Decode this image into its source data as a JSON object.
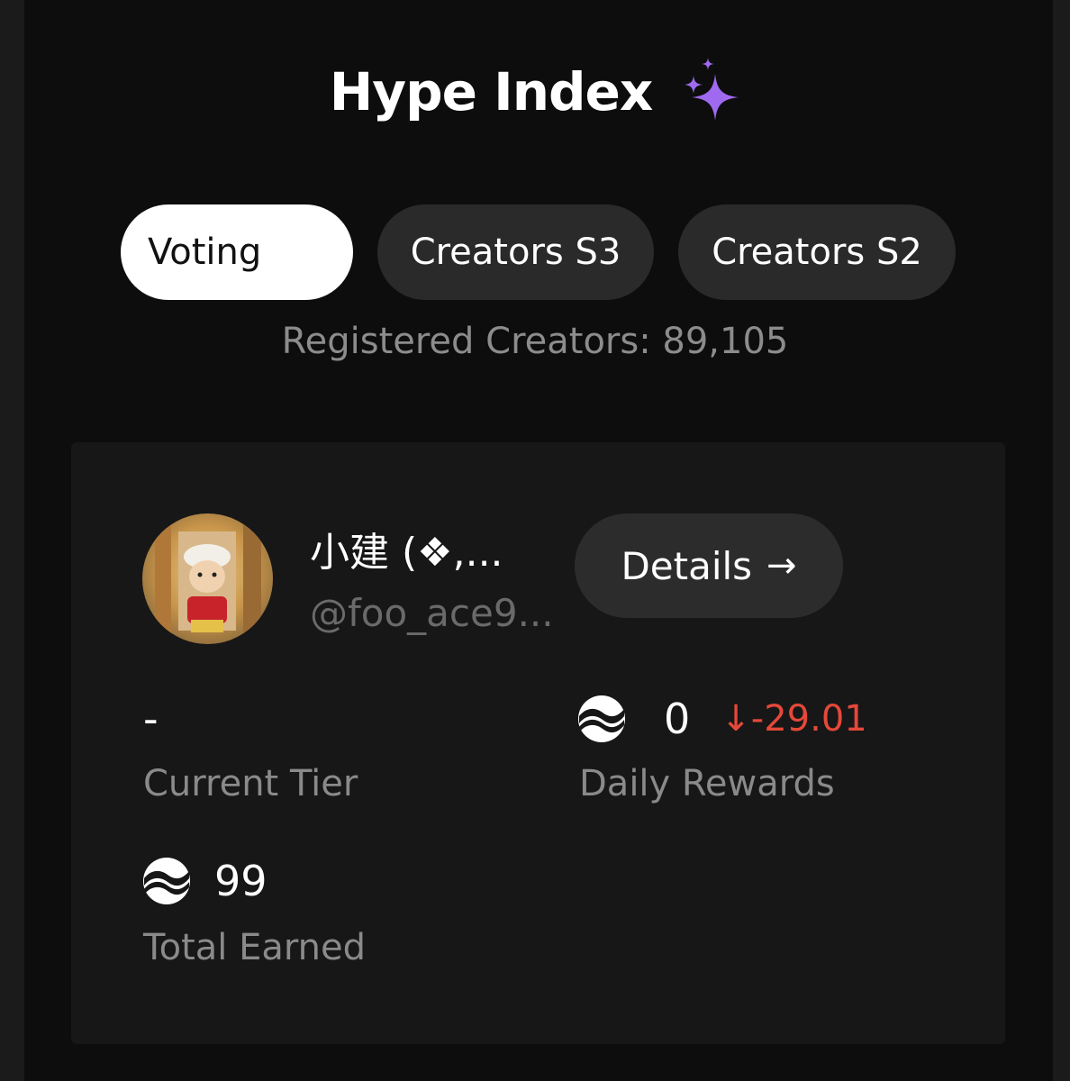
{
  "header": {
    "title": "Hype Index",
    "title_icon": "sparkle-icon",
    "accent_color": "#a06af0"
  },
  "tabs": [
    {
      "label": "Voting",
      "active": true
    },
    {
      "label": "Creators S3",
      "active": false
    },
    {
      "label": "Creators S2",
      "active": false
    }
  ],
  "registered_creators": "Registered Creators: 89,105",
  "card": {
    "user": {
      "display_name": "小建 (❖,...",
      "handle": "@foo_ace9...",
      "avatar_icon": "avatar"
    },
    "details_button": {
      "label": "Details",
      "arrow": "→"
    },
    "current_tier": {
      "value": "-",
      "label": "Current Tier"
    },
    "daily_rewards": {
      "value": "0",
      "change": "↓-29.01",
      "change_color": "#e5483a",
      "label": "Daily Rewards",
      "icon": "coin-icon"
    },
    "total_earned": {
      "value": "99",
      "label": "Total Earned",
      "icon": "coin-icon"
    }
  }
}
